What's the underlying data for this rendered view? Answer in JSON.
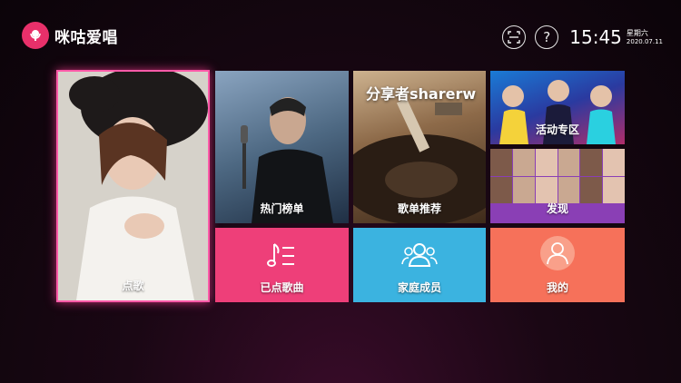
{
  "app": {
    "name": "咪咕爱唱"
  },
  "header": {
    "time": "15:45",
    "weekday": "星期六",
    "date": "2020.07.11"
  },
  "watermark": "分享者sharerw",
  "tiles": {
    "sing": "点歌",
    "hot_chart": "热门榜单",
    "recommend": "歌单推荐",
    "event": "活动专区",
    "discover": "发现",
    "ordered": "已点歌曲",
    "family": "家庭成员",
    "mine": "我的"
  },
  "colors": {
    "accent": "#e8306a",
    "ordered": "#ee3f79",
    "family": "#3bb3e0",
    "mine": "#f6715a",
    "discover": "#8a3fb5"
  }
}
